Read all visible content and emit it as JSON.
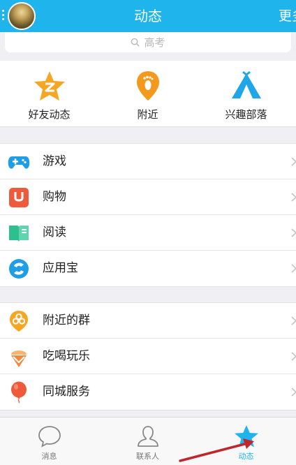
{
  "header": {
    "title": "动态",
    "more_label": "更多"
  },
  "search": {
    "placeholder": "高考"
  },
  "quick_links": [
    {
      "label": "好友动态",
      "icon": "star-z-icon",
      "color": "#f5a623"
    },
    {
      "label": "附近",
      "icon": "footprint-location-icon",
      "color": "#f39a1e"
    },
    {
      "label": "兴趣部落",
      "icon": "tent-icon",
      "color": "#1fa6e8"
    }
  ],
  "group1": [
    {
      "label": "游戏",
      "icon": "gamepad-icon",
      "color": "#1f9ee8"
    },
    {
      "label": "购物",
      "icon": "shopping-bag-icon",
      "color": "#ee5a3c"
    },
    {
      "label": "阅读",
      "icon": "book-icon",
      "color": "#2dbf8e"
    },
    {
      "label": "应用宝",
      "icon": "app-store-icon",
      "color": "#1f9ee8"
    }
  ],
  "group2": [
    {
      "label": "附近的群",
      "icon": "nearby-group-icon",
      "color": "#f5a623"
    },
    {
      "label": "吃喝玩乐",
      "icon": "ice-cream-icon",
      "color": "#f0883e"
    },
    {
      "label": "同城服务",
      "icon": "balloon-icon",
      "color": "#ee5a3c"
    }
  ],
  "tabbar": [
    {
      "label": "消息",
      "icon": "chat-bubble-icon",
      "active": false
    },
    {
      "label": "联系人",
      "icon": "contact-person-icon",
      "active": false
    },
    {
      "label": "动态",
      "icon": "star-icon",
      "active": true
    }
  ],
  "colors": {
    "brand": "#1fb5ec",
    "arrow": "#c0272d"
  }
}
